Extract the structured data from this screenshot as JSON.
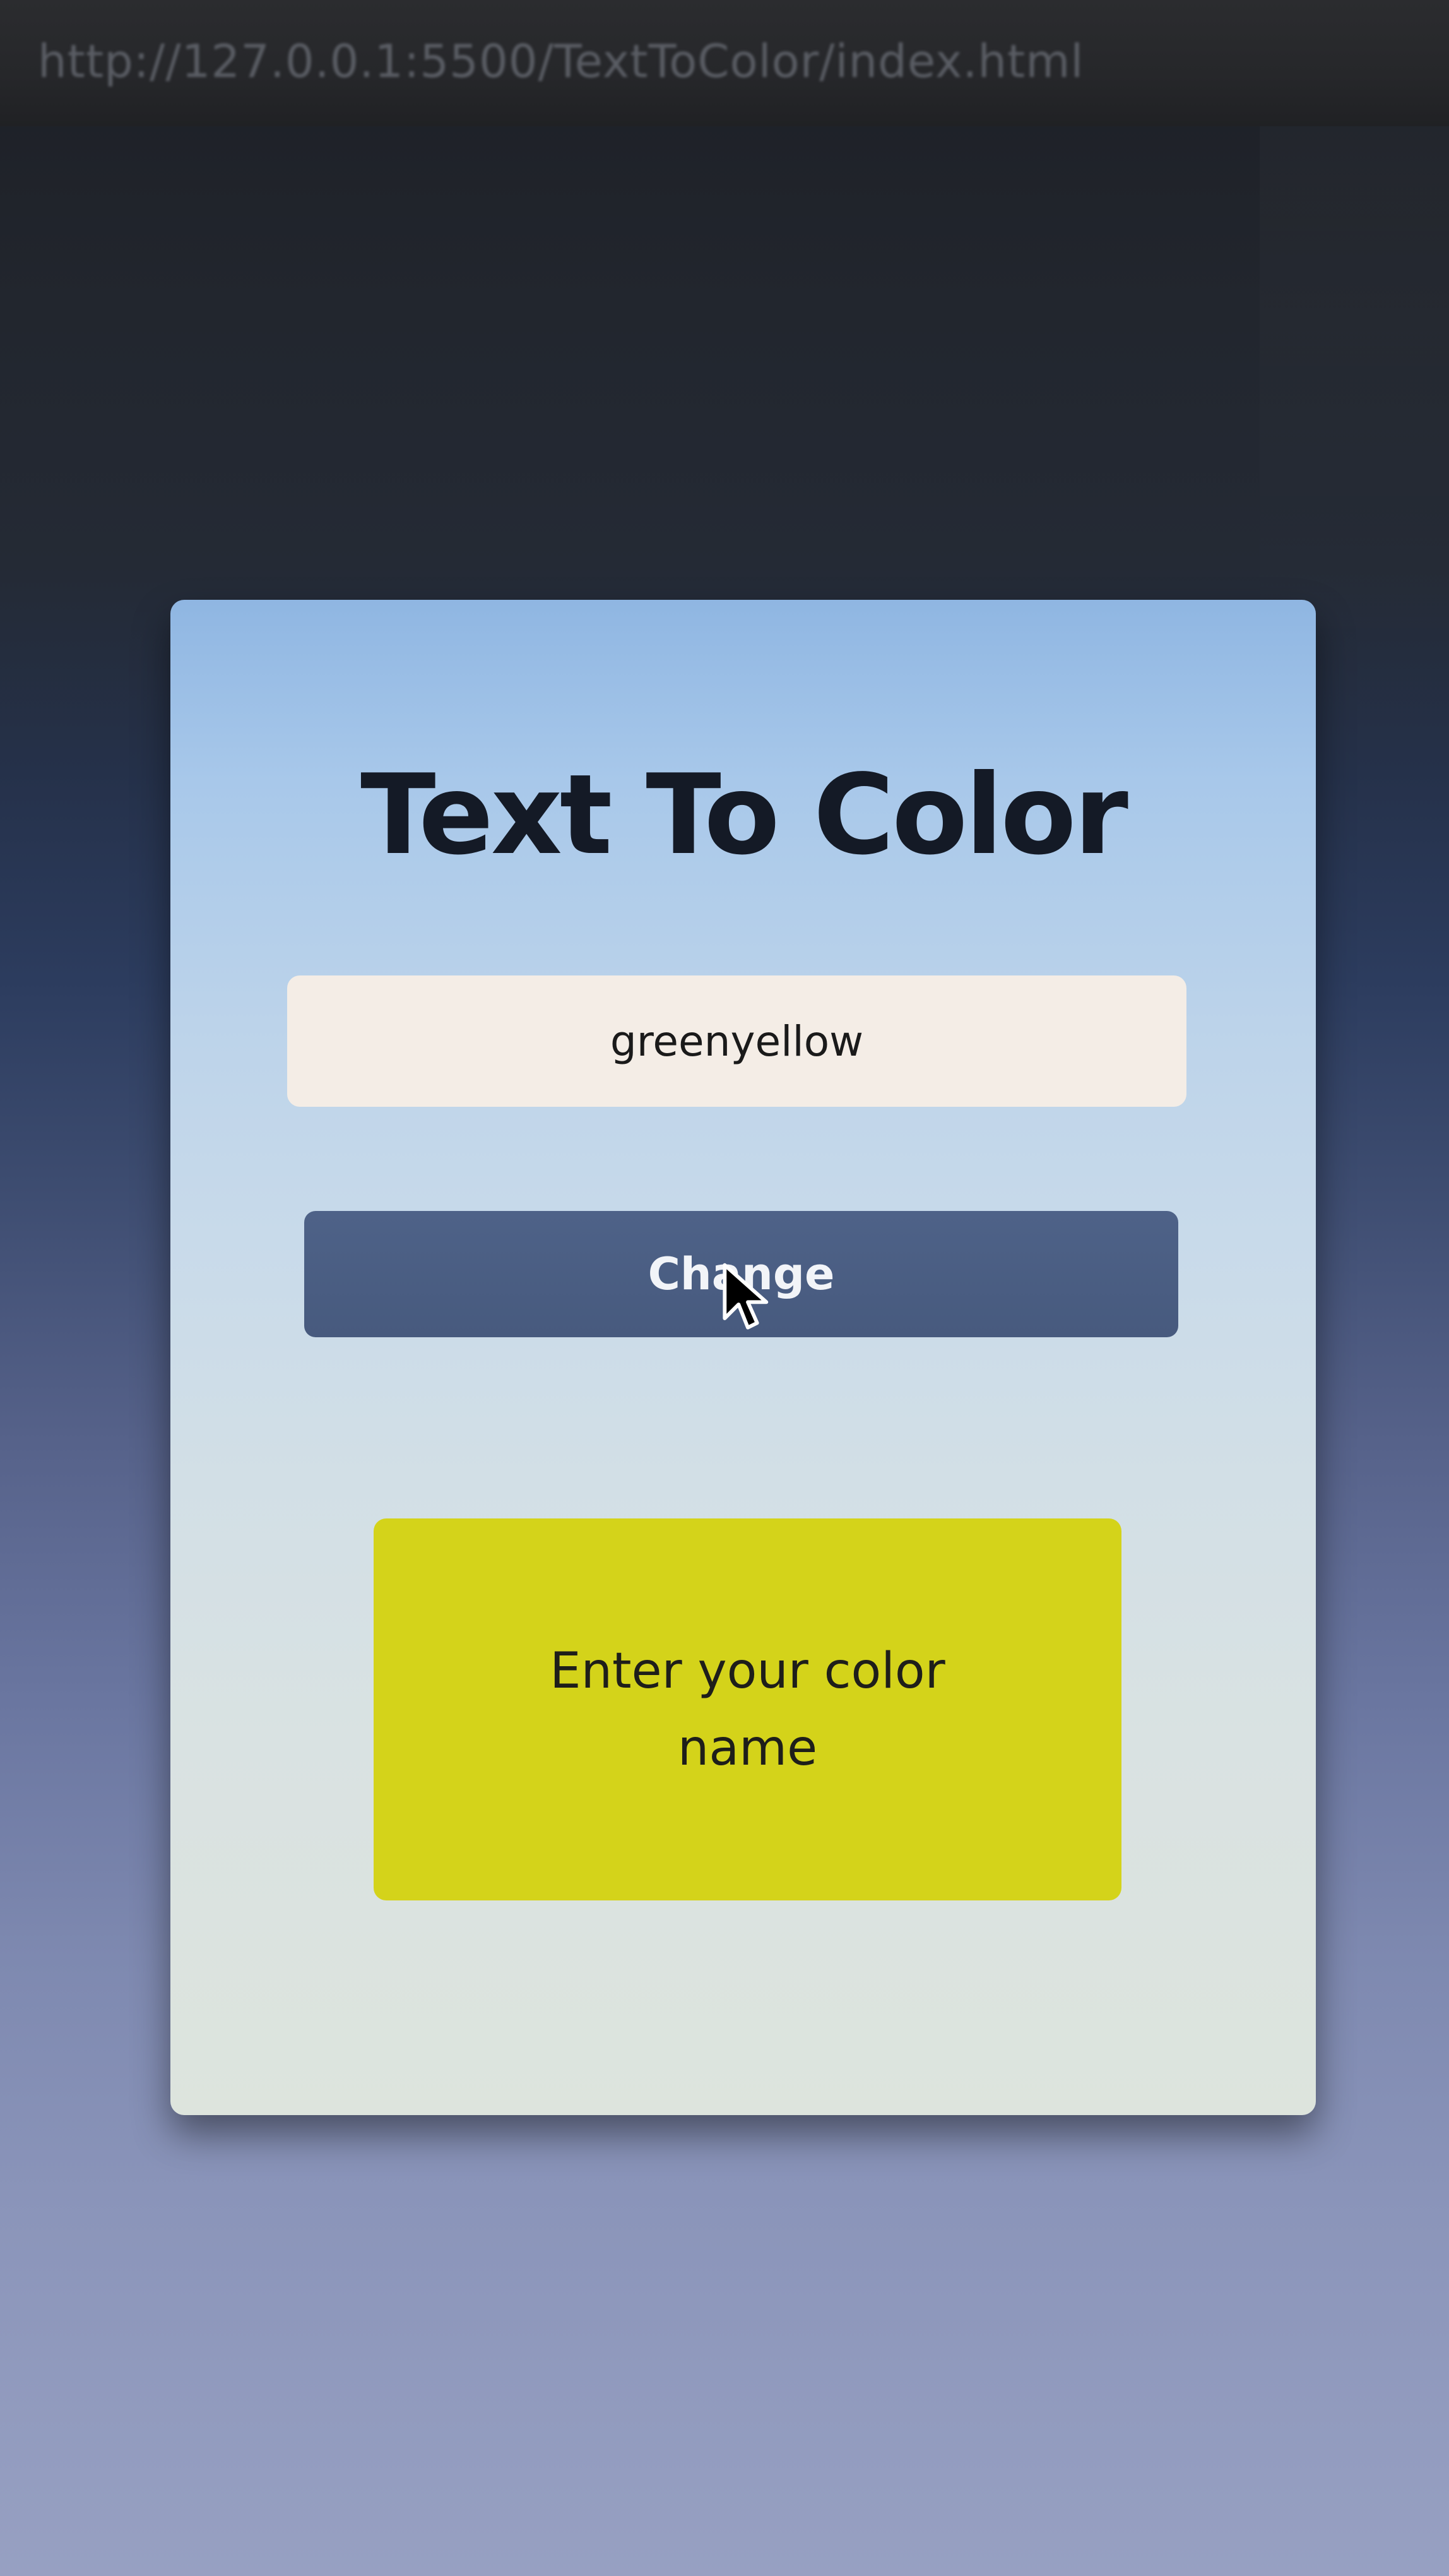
{
  "browser": {
    "url": "http://127.0.0.1:5500/TextToColor/index.html"
  },
  "card": {
    "title": "Text To Color",
    "input": {
      "value": "greenyellow",
      "placeholder": ""
    },
    "change_button_label": "Change",
    "color_box_text": "Enter your color name"
  },
  "colors": {
    "button": "#4e6288",
    "input_background": "#f4ede6",
    "color_box": "#d4d31a",
    "title": "#141a26"
  },
  "cursor_icon": "arrow-cursor-icon"
}
